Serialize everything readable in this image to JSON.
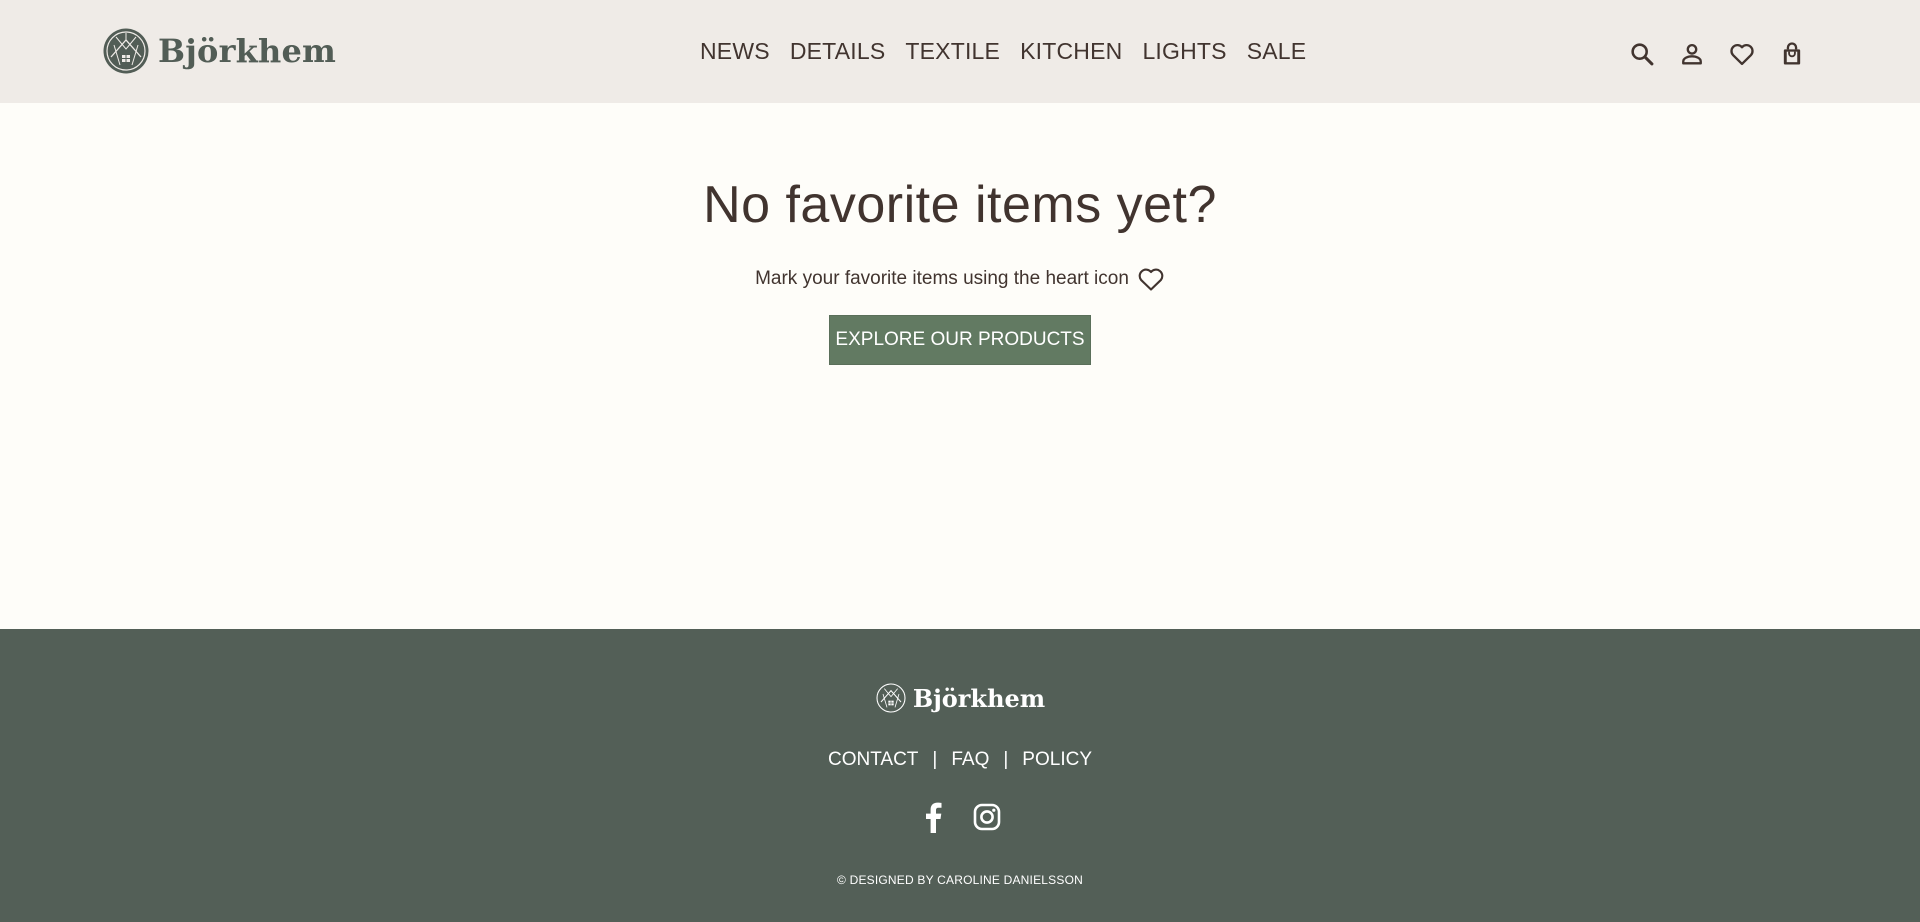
{
  "header": {
    "logo_text": "Björkhem",
    "nav": [
      "NEWS",
      "DETAILS",
      "TEXTILE",
      "KITCHEN",
      "LIGHTS",
      "SALE"
    ],
    "icons": [
      "search-icon",
      "account-icon",
      "heart-icon",
      "shopping-bag-icon"
    ]
  },
  "main": {
    "title": "No favorite items yet?",
    "hint": "Mark your favorite items using the heart icon",
    "hint_icon": "heart-icon",
    "cta_label": "EXPLORE OUR PRODUCTS"
  },
  "footer": {
    "logo_text": "Björkhem",
    "links": [
      "CONTACT",
      "FAQ",
      "POLICY"
    ],
    "separator": "|",
    "social_icons": [
      "facebook-icon",
      "instagram-icon"
    ],
    "credit": "© DESIGNED BY CAROLINE DANIELSSON"
  },
  "colors": {
    "header_bg": "#efebe7",
    "page_bg": "#fefdf9",
    "text": "#41342f",
    "brand_green": "#525d56",
    "button_bg": "#627a62",
    "footer_bg": "#535f57"
  }
}
